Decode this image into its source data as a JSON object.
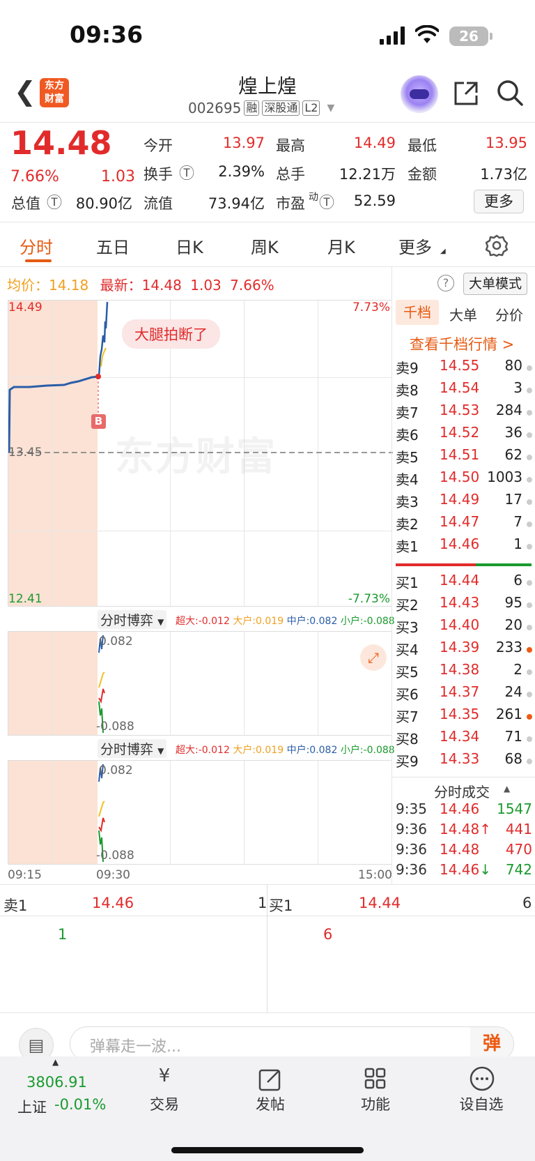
{
  "status": {
    "time": "09:36",
    "battery": "26"
  },
  "header": {
    "logo": "东方\n财富",
    "title": "煌上煌",
    "code": "002695",
    "tags": [
      "融",
      "深股通",
      "L2"
    ]
  },
  "quote": {
    "price": "14.48",
    "pct": "7.66%",
    "change": "1.03",
    "stats": [
      {
        "label": "今开",
        "value": "13.97",
        "color": "red"
      },
      {
        "label": "最高",
        "value": "14.49",
        "color": "red"
      },
      {
        "label": "最低",
        "value": "13.95",
        "color": "red"
      },
      {
        "label": "换手",
        "value": "2.39%",
        "color": "dark"
      },
      {
        "label": "总手",
        "value": "12.21万",
        "color": "dark"
      },
      {
        "label": "金额",
        "value": "1.73亿",
        "color": "dark"
      },
      {
        "label": "总值",
        "value": "80.90亿",
        "color": "dark"
      },
      {
        "label": "流值",
        "value": "73.94亿",
        "color": "dark"
      },
      {
        "label": "市盈",
        "value": "52.59",
        "color": "dark",
        "sup": "动"
      }
    ],
    "more": "更多"
  },
  "tabs": [
    "分时",
    "五日",
    "日K",
    "周K",
    "月K",
    "更多"
  ],
  "avgline": {
    "avg_label": "均价：",
    "avg": "14.18",
    "latest_label": "最新：",
    "latest": "14.48",
    "chg": "1.03",
    "pct": "7.66%",
    "big_mode": "大单模式"
  },
  "chart": {
    "high": "14.49",
    "low": "12.41",
    "base": "13.45",
    "top_pct": "7.73%",
    "bottom_pct": "-7.73%",
    "bubble": "大腿拍断了",
    "watermark": "东方财富",
    "marker": "B",
    "x_start": "09:15",
    "x_mid": "09:30",
    "x_end": "15:00"
  },
  "indicator": {
    "name": "分时博弈",
    "super_label": "超大:",
    "super": "-0.012",
    "big_label": "大户:",
    "big": "0.019",
    "mid_label": "中户:",
    "mid": "0.082",
    "small_label": "小户:",
    "small": "-0.088",
    "top": "0.082",
    "bottom": "-0.088"
  },
  "side": {
    "tabs": [
      "千档",
      "大单",
      "分价"
    ],
    "view": "查看千档行情 >",
    "asks": [
      [
        "卖9",
        "14.55",
        "80",
        false
      ],
      [
        "卖8",
        "14.54",
        "3",
        false
      ],
      [
        "卖7",
        "14.53",
        "284",
        false
      ],
      [
        "卖6",
        "14.52",
        "36",
        false
      ],
      [
        "卖5",
        "14.51",
        "62",
        false
      ],
      [
        "卖4",
        "14.50",
        "1003",
        false
      ],
      [
        "卖3",
        "14.49",
        "17",
        false
      ],
      [
        "卖2",
        "14.47",
        "7",
        false
      ],
      [
        "卖1",
        "14.46",
        "1",
        false
      ]
    ],
    "bids": [
      [
        "买1",
        "14.44",
        "6",
        false
      ],
      [
        "买2",
        "14.43",
        "95",
        false
      ],
      [
        "买3",
        "14.40",
        "20",
        false
      ],
      [
        "买4",
        "14.39",
        "233",
        true
      ],
      [
        "买5",
        "14.38",
        "2",
        false
      ],
      [
        "买6",
        "14.37",
        "24",
        false
      ],
      [
        "买7",
        "14.35",
        "261",
        true
      ],
      [
        "买8",
        "14.34",
        "71",
        false
      ],
      [
        "买9",
        "14.33",
        "68",
        false
      ]
    ],
    "trades_title": "分时成交",
    "trades": [
      [
        "9:35",
        "14.46",
        "",
        "1547",
        "green"
      ],
      [
        "9:36",
        "14.48",
        "↑",
        "441",
        "red"
      ],
      [
        "9:36",
        "14.48",
        "",
        "470",
        "red"
      ],
      [
        "9:36",
        "14.46",
        "↓",
        "742",
        "green"
      ]
    ]
  },
  "bottom": {
    "sell_label": "卖1",
    "sell_price": "14.46",
    "sell_qty": "1",
    "buy_label": "买1",
    "buy_price": "14.44",
    "buy_qty": "6",
    "sell_detail": "1",
    "buy_detail": "6"
  },
  "danmu": {
    "placeholder": "弹幕走一波...",
    "btn": "弹"
  },
  "footer": {
    "index": "3806.91",
    "index_name": "上证",
    "index_pct": "-0.01%",
    "items": [
      "交易",
      "发帖",
      "功能",
      "设自选"
    ]
  }
}
